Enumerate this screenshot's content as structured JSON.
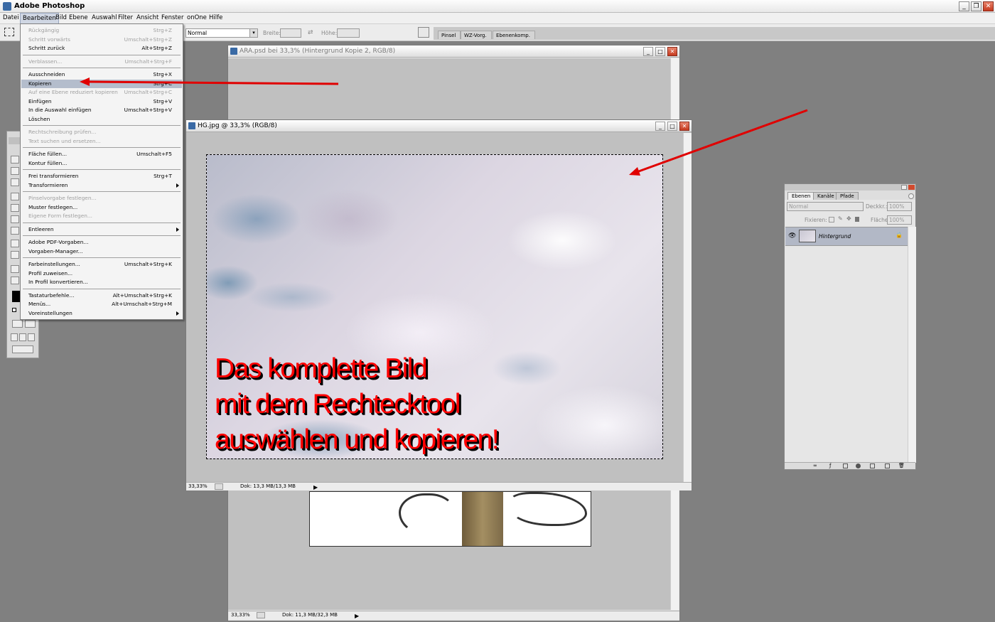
{
  "app": {
    "title": "Adobe Photoshop"
  },
  "menubar": [
    "Datei",
    "Bearbeiten",
    "Bild",
    "Ebene",
    "Auswahl",
    "Filter",
    "Ansicht",
    "Fenster",
    "onOne",
    "Hilfe"
  ],
  "options": {
    "mode": "Normal",
    "width_label": "Breite:",
    "height_label": "Höhe:",
    "palette_tabs": [
      "Pinsel",
      "WZ-Vorg.",
      "Ebenenkomp."
    ]
  },
  "edit_menu": {
    "items": [
      {
        "label": "Rückgängig",
        "key": "Strg+Z",
        "disabled": true
      },
      {
        "label": "Schritt vorwärts",
        "key": "Umschalt+Strg+Z",
        "disabled": true
      },
      {
        "label": "Schritt zurück",
        "key": "Alt+Strg+Z"
      },
      {
        "sep": true
      },
      {
        "label": "Verblassen...",
        "key": "Umschalt+Strg+F",
        "disabled": true
      },
      {
        "sep": true
      },
      {
        "label": "Ausschneiden",
        "key": "Strg+X"
      },
      {
        "label": "Kopieren",
        "key": "Strg+C",
        "highlight": true
      },
      {
        "label": "Auf eine Ebene reduziert kopieren",
        "key": "Umschalt+Strg+C",
        "disabled": true
      },
      {
        "label": "Einfügen",
        "key": "Strg+V"
      },
      {
        "label": "In die Auswahl einfügen",
        "key": "Umschalt+Strg+V"
      },
      {
        "label": "Löschen",
        "key": ""
      },
      {
        "sep": true
      },
      {
        "label": "Rechtschreibung prüfen...",
        "key": "",
        "disabled": true
      },
      {
        "label": "Text suchen und ersetzen...",
        "key": "",
        "disabled": true
      },
      {
        "sep": true
      },
      {
        "label": "Fläche füllen...",
        "key": "Umschalt+F5"
      },
      {
        "label": "Kontur füllen...",
        "key": ""
      },
      {
        "sep": true
      },
      {
        "label": "Frei transformieren",
        "key": "Strg+T"
      },
      {
        "label": "Transformieren",
        "key": "",
        "submenu": true
      },
      {
        "sep": true
      },
      {
        "label": "Pinselvorgabe festlegen...",
        "key": "",
        "disabled": true
      },
      {
        "label": "Muster festlegen...",
        "key": ""
      },
      {
        "label": "Eigene Form festlegen...",
        "key": "",
        "disabled": true
      },
      {
        "sep": true
      },
      {
        "label": "Entleeren",
        "key": "",
        "submenu": true
      },
      {
        "sep": true
      },
      {
        "label": "Adobe PDF-Vorgaben...",
        "key": ""
      },
      {
        "label": "Vorgaben-Manager...",
        "key": ""
      },
      {
        "sep": true
      },
      {
        "label": "Farbeinstellungen...",
        "key": "Umschalt+Strg+K"
      },
      {
        "label": "Profil zuweisen...",
        "key": ""
      },
      {
        "label": "In Profil konvertieren...",
        "key": ""
      },
      {
        "sep": true
      },
      {
        "label": "Tastaturbefehle...",
        "key": "Alt+Umschalt+Strg+K"
      },
      {
        "label": "Menüs...",
        "key": "Alt+Umschalt+Strg+M"
      },
      {
        "label": "Voreinstellungen",
        "key": "",
        "submenu": true
      }
    ]
  },
  "doc_back": {
    "title": "ARA.psd bei 33,3% (Hintergrund Kopie 2, RGB/8)",
    "zoom": "33,33%",
    "doc_info": "Dok: 11,3 MB/32,3 MB"
  },
  "doc_front": {
    "title": "HG.jpg @ 33,3% (RGB/8)",
    "zoom": "33,33%",
    "doc_info": "Dok: 13,3 MB/13,3 MB"
  },
  "overlay_text": [
    "Das komplette Bild",
    "mit dem Rechtecktool",
    "auswählen und kopieren!"
  ],
  "layers": {
    "tabs": [
      "Ebenen",
      "Kanäle",
      "Pfade"
    ],
    "blend_mode": "Normal",
    "opacity_label": "Deckkr.:",
    "opacity": "100%",
    "lock_label": "Fixieren:",
    "fill_label": "Fläche:",
    "fill": "100%",
    "layer_name": "Hintergrund"
  },
  "colors": {
    "annotation": "#ff0000",
    "highlight": "#b4bdcc"
  }
}
